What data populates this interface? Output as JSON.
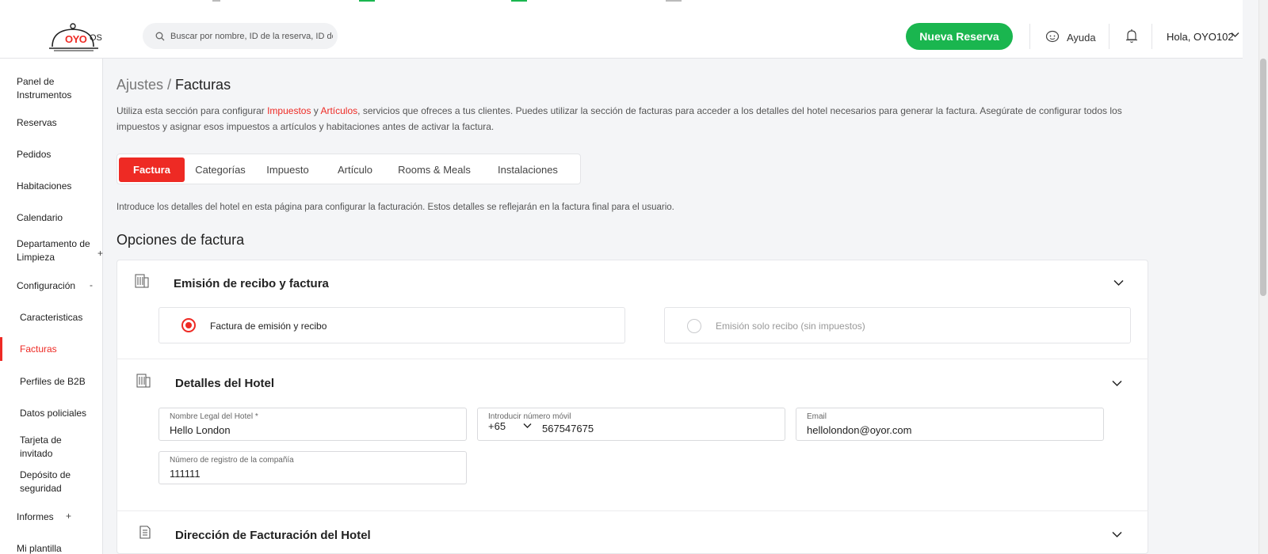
{
  "header": {
    "logo_brand": "OYO",
    "logo_suffix": "OS",
    "search_placeholder": "Buscar por nombre, ID de la reserva, ID de",
    "new_booking_label": "Nueva Reserva",
    "help_label": "Ayuda",
    "user_label": "Hola, OYO102"
  },
  "sidebar": {
    "dashboard": "Panel de Instrumentos",
    "bookings": "Reservas",
    "orders": "Pedidos",
    "rooms": "Habitaciones",
    "calendar": "Calendario",
    "housekeeping": "Departamento de Limpieza",
    "housekeeping_toggle": "+",
    "config": "Configuración",
    "config_toggle": "-",
    "features": "Caracteristicas",
    "invoices": "Facturas",
    "b2b": "Perfiles de B2B",
    "police": "Datos policiales",
    "guest_card": "Tarjeta de invitado",
    "deposit": "Depósito de seguridad",
    "reports": "Informes",
    "reports_toggle": "+",
    "template": "Mi plantilla"
  },
  "main": {
    "breadcrumb_parent": "Ajustes /",
    "breadcrumb_current": "Facturas",
    "intro_part1": "Utiliza esta sección para configurar ",
    "intro_link1": "Impuestos",
    "intro_part2": " y ",
    "intro_link2": "Artículos",
    "intro_part3": ", servicios que ofreces a tus clientes. Puedes utilizar la sección de facturas para acceder a los detalles del hotel necesarios para generar la factura. Asegúrate de configurar todos los impuestos y asignar esos impuestos a artículos y habitaciones antes de activar la factura.",
    "tabs": [
      "Factura",
      "Categorías",
      "Impuesto",
      "Artículo",
      "Rooms & Meals",
      "Instalaciones"
    ],
    "helper_text": "Introduce los detalles del hotel en esta página para configurar la facturación. Estos detalles se reflejarán en la factura final para el usuario.",
    "section_title": "Opciones de factura"
  },
  "receipt_section": {
    "title": "Emisión de recibo y factura",
    "option_invoice": "Factura de emisión y recibo",
    "option_receipt_only": "Emisión solo recibo (sin impuestos)",
    "selected": "Factura de emisión y recibo"
  },
  "hotel_details": {
    "title": "Detalles del Hotel",
    "legal_name_label": "Nombre Legal del Hotel *",
    "legal_name_value": "Hello London",
    "phone_label": "Introducir número móvil",
    "phone_code": "+65",
    "phone_value": "567547675",
    "email_label": "Email",
    "email_value": "hellolondon@oyor.com",
    "registration_label": "Número de registro de la compañía",
    "registration_value": "111111"
  },
  "billing_address": {
    "title": "Dirección de Facturación del Hotel"
  },
  "colors": {
    "brand_red": "#ee2a24",
    "primary_green": "#1ab64f"
  }
}
